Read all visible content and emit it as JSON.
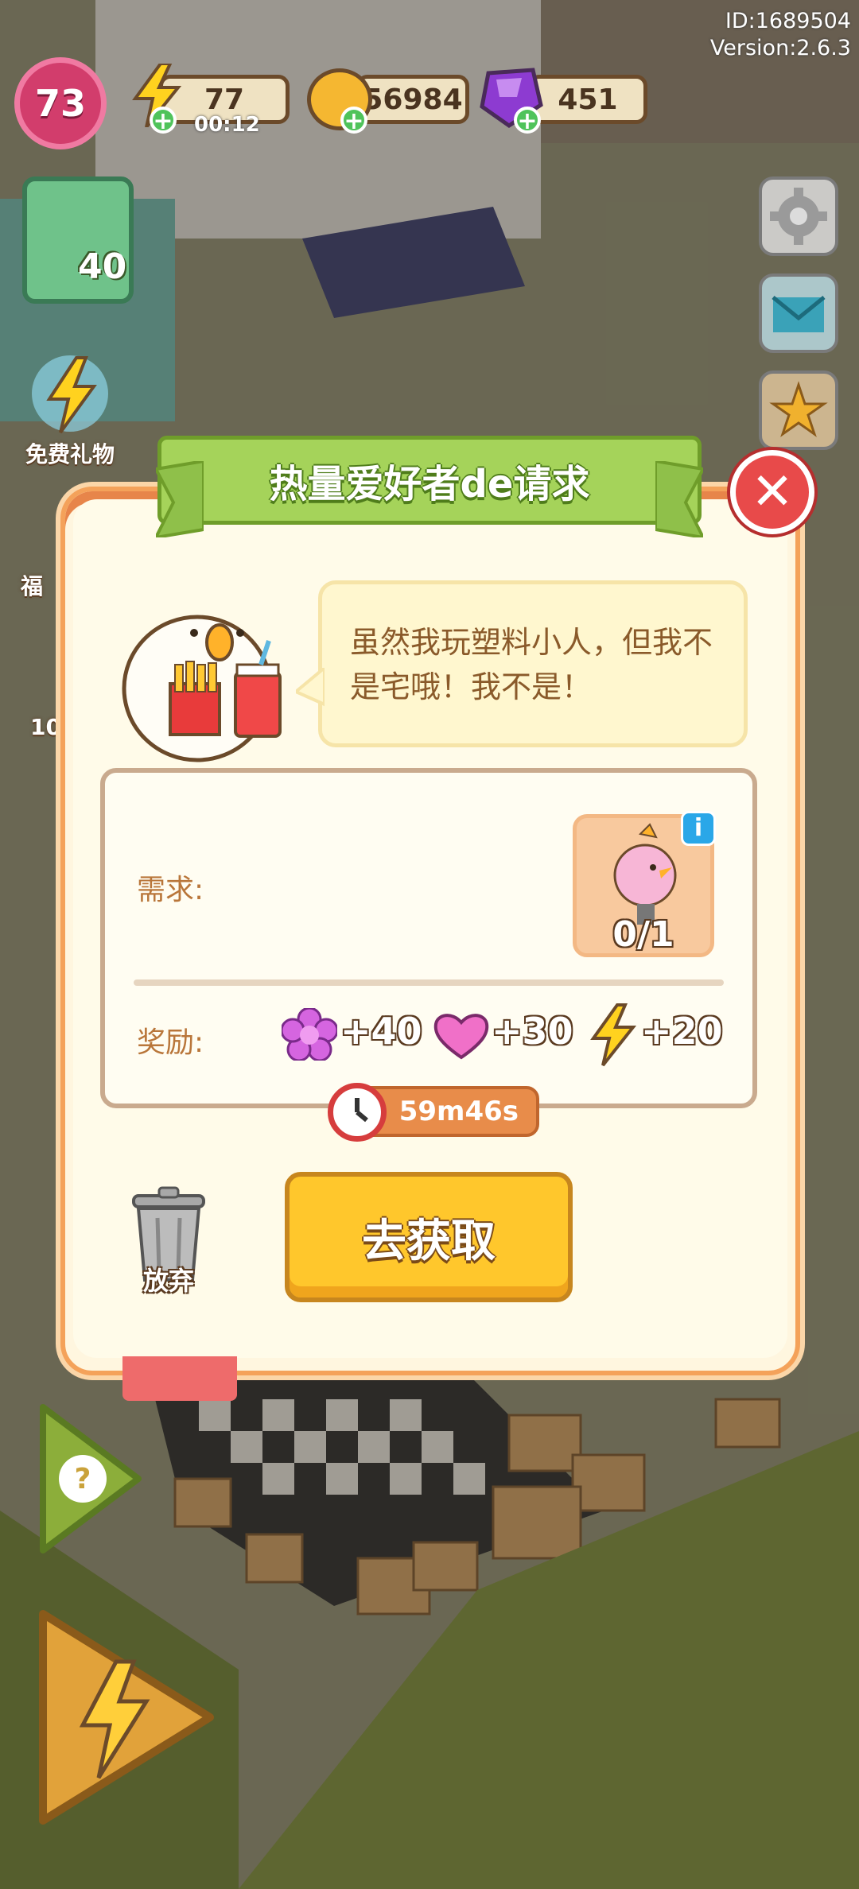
{
  "top_info": {
    "id_text": "ID:1689504",
    "version_text": "Version:2.6.3"
  },
  "hud": {
    "level": "73",
    "energy": "77",
    "energy_timer": "00:12",
    "coins": "56984",
    "gems": "451"
  },
  "left_panel": {
    "card_count": "40",
    "free_gift_label": "免费礼物",
    "partial_label_1": "福",
    "partial_count": "10"
  },
  "dialog": {
    "title": "热量爱好者de请求",
    "speech": "虽然我玩塑料小人，但我不是宅哦！我不是！",
    "requirement_label": "需求:",
    "requirement_progress": "0/1",
    "reward_label": "奖励:",
    "rewards": [
      {
        "icon": "purple-flower-icon",
        "text": "+40"
      },
      {
        "icon": "heart-icon",
        "text": "+30"
      },
      {
        "icon": "lightning-icon",
        "text": "+20"
      }
    ],
    "timer": "59m46s",
    "go_button": "去获取",
    "discard_label": "放弃"
  },
  "colors": {
    "banner_green": "#a5d35a",
    "button_yellow": "#ffc72c",
    "close_red": "#e84a4a",
    "dialog_bg": "#fff6df"
  }
}
